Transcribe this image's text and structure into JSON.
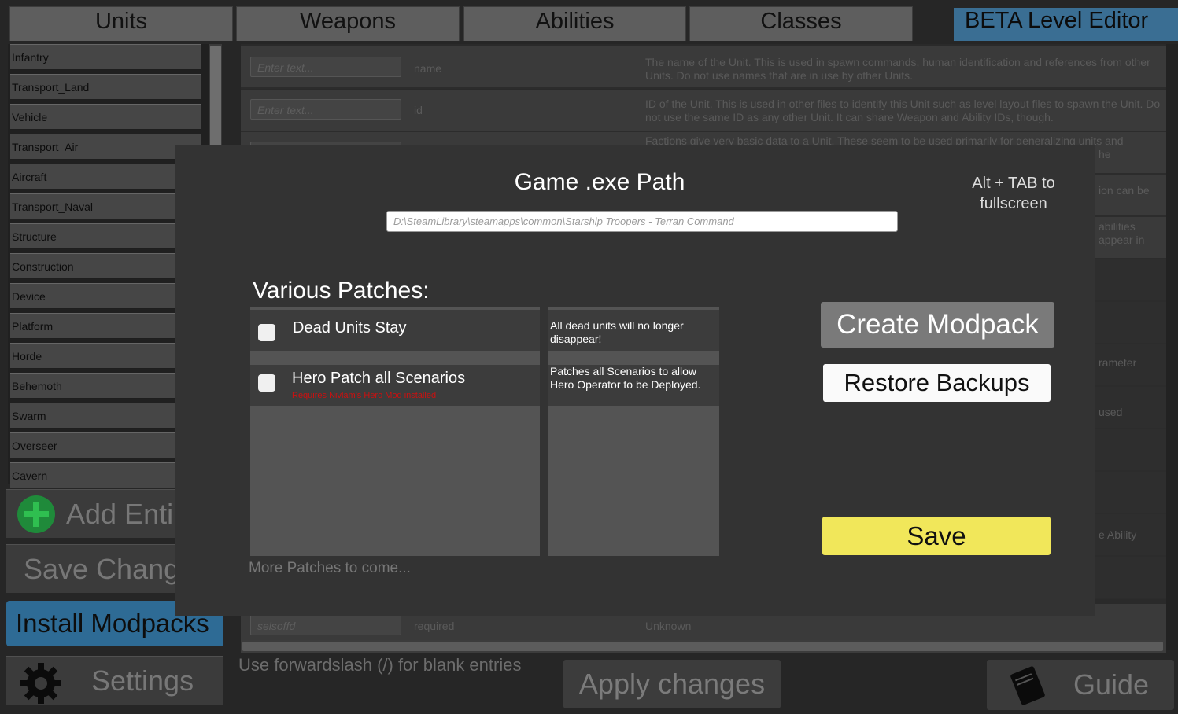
{
  "tabs": [
    {
      "label": "Units"
    },
    {
      "label": "Weapons"
    },
    {
      "label": "Abilities"
    },
    {
      "label": "Classes"
    },
    {
      "label": "BETA Level Editor"
    }
  ],
  "unit_classes": [
    "Infantry",
    "Transport_Land",
    "Vehicle",
    "Transport_Air",
    "Aircraft",
    "Transport_Naval",
    "Structure",
    "Construction",
    "Device",
    "Platform",
    "Horde",
    "Behemoth",
    "Swarm",
    "Overseer",
    "Cavern"
  ],
  "left_buttons": {
    "add_entity": "Add Enti",
    "save_changes": "Save Chang",
    "install_modpacks": "Install Modpacks",
    "settings": "Settings"
  },
  "table_rows": [
    {
      "placeholder": "Enter text...",
      "name": "name",
      "desc": "The name of the Unit. This is used in spawn commands, human identification and references from other Units. Do not use names that are in use by other Units."
    },
    {
      "placeholder": "Enter text...",
      "name": "id",
      "desc": "ID of the Unit. This is used in other files to identify this Unit such as level layout files to spawn the Unit. Do not use the same ID as any other Unit. It can share Weapon and Ability IDs, though."
    },
    {
      "placeholder": "",
      "name": "",
      "desc": "Factions give very basic data to a Unit. These seem to be used primarily for generalizing units and"
    }
  ],
  "right_fragments": [
    "he",
    "ion can be",
    "abilities",
    "appear in",
    "rameter",
    "used",
    "e Ability"
  ],
  "bottom_row": {
    "placeholder": "selsoffd",
    "name": "required",
    "desc": "Unknown"
  },
  "hint": "Use forwardslash (/) for blank entries",
  "apply_changes": "Apply changes",
  "guide": "Guide",
  "modal": {
    "title": "Game .exe Path",
    "alt_hint": "Alt + TAB to fullscreen",
    "path_value": "D:\\SteamLibrary\\steamapps\\common\\Starship Troopers - Terran Command",
    "patches_heading": "Various Patches:",
    "patches": [
      {
        "label": "Dead Units Stay",
        "requirement": "",
        "description": "All dead units will no longer disappear!",
        "checked": false
      },
      {
        "label": "Hero Patch all Scenarios",
        "requirement": "Requires Nivlam's Hero Mod installed",
        "description": "Patches all Scenarios to allow Hero Operator to be Deployed.",
        "checked": false
      }
    ],
    "more_patches": "More Patches to come...",
    "create_modpack": "Create Modpack",
    "restore_backups": "Restore Backups",
    "save": "Save"
  },
  "colors": {
    "beta_tab": "#3a6e93",
    "install_button": "#2e6b95",
    "save_button": "#f1e75a",
    "requirement_text": "#cc1010",
    "add_icon": "#1f8a3a"
  }
}
